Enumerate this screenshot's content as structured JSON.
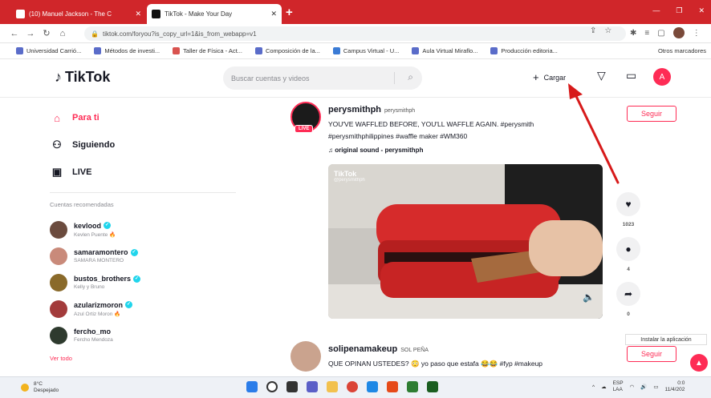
{
  "browser": {
    "tabs": [
      {
        "title": "(10) Manuel Jackson - The C",
        "active": false
      },
      {
        "title": "TikTok - Make Your Day",
        "active": true
      }
    ],
    "new_tab": "+",
    "url": "tiktok.com/foryou?is_copy_url=1&is_from_webapp=v1",
    "bookmarks": [
      "Universidad Carrió...",
      "Métodos de investi...",
      "Taller de Física - Act...",
      "Composición de la...",
      "Campus Virtual - U...",
      "Aula Virtual Miraflo...",
      "Producción editoria..."
    ],
    "bookmarks_more": "Otros marcadores"
  },
  "header": {
    "logo": "TikTok",
    "search_placeholder": "Buscar cuentas y videos",
    "upload_label": "Cargar",
    "avatar_letter": "A"
  },
  "sidebar": {
    "nav": [
      {
        "label": "Para ti",
        "icon": "home-icon",
        "active": true
      },
      {
        "label": "Siguiendo",
        "icon": "following-icon",
        "active": false
      },
      {
        "label": "LIVE",
        "icon": "live-icon",
        "active": false
      }
    ],
    "suggested_title": "Cuentas recomendadas",
    "accounts": [
      {
        "username": "kevlood",
        "display": "Kevlen Puente 🔥",
        "verified": true,
        "color": "#6b4b3e"
      },
      {
        "username": "samaramontero",
        "display": "SAMARA MONTERO",
        "verified": true,
        "color": "#c98a7a"
      },
      {
        "username": "bustos_brothers",
        "display": "Kelly y Bruno",
        "verified": true,
        "color": "#8a6a2a"
      },
      {
        "username": "azularizmoron",
        "display": "Azul Ortiz Moron 🔥",
        "verified": true,
        "color": "#a33b3b"
      },
      {
        "username": "fercho_mo",
        "display": "Fercho Mendoza",
        "verified": false,
        "color": "#2e3a2e"
      }
    ],
    "see_all": "Ver todo"
  },
  "post1": {
    "username": "perysmithph",
    "nickname": "perysmithph",
    "live": "LIVE",
    "caption_line1": "YOU'VE WAFFLED BEFORE, YOU'LL WAFFLE AGAIN. #perysmith",
    "caption_line2": "#perysmithphilippines #waffle maker #WM360",
    "sound": "♫ original sound - perysmithph",
    "follow": "Seguir",
    "watermark": "TikTok",
    "watermark_handle": "@perysmithph",
    "likes": "1023",
    "comments": "4",
    "shares": "0"
  },
  "post2": {
    "username": "solipenamakeup",
    "nickname": "SOL PEÑA",
    "caption": "QUE OPINAN USTEDES? 😳 yo paso que estafa 😂😂 #fyp #makeup",
    "follow": "Seguir",
    "tooltip": "Instalar la aplicación"
  },
  "taskbar": {
    "temp": "8°C",
    "weather": "Despejado",
    "lang1": "ESP",
    "lang2": "LAA",
    "time": "0:0",
    "date": "11/4/202"
  },
  "colors": {
    "accent": "#fe2c55",
    "tab_red": "#d0262a",
    "annotation": "#d71a1a"
  }
}
